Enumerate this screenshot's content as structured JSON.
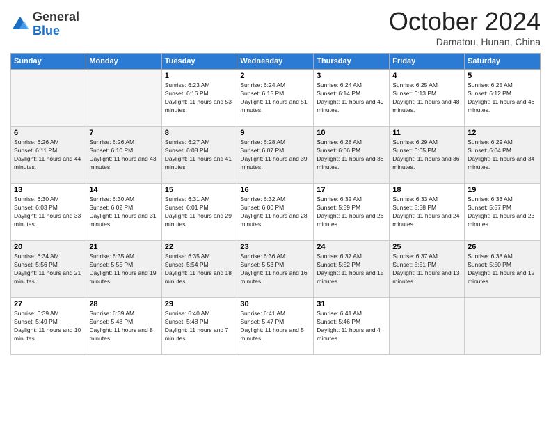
{
  "logo": {
    "general": "General",
    "blue": "Blue"
  },
  "header": {
    "month": "October 2024",
    "location": "Damatou, Hunan, China"
  },
  "weekdays": [
    "Sunday",
    "Monday",
    "Tuesday",
    "Wednesday",
    "Thursday",
    "Friday",
    "Saturday"
  ],
  "weeks": [
    [
      {
        "num": "",
        "empty": true
      },
      {
        "num": "",
        "empty": true
      },
      {
        "num": "1",
        "sunrise": "6:23 AM",
        "sunset": "6:16 PM",
        "daylight": "11 hours and 53 minutes."
      },
      {
        "num": "2",
        "sunrise": "6:24 AM",
        "sunset": "6:15 PM",
        "daylight": "11 hours and 51 minutes."
      },
      {
        "num": "3",
        "sunrise": "6:24 AM",
        "sunset": "6:14 PM",
        "daylight": "11 hours and 49 minutes."
      },
      {
        "num": "4",
        "sunrise": "6:25 AM",
        "sunset": "6:13 PM",
        "daylight": "11 hours and 48 minutes."
      },
      {
        "num": "5",
        "sunrise": "6:25 AM",
        "sunset": "6:12 PM",
        "daylight": "11 hours and 46 minutes."
      }
    ],
    [
      {
        "num": "6",
        "sunrise": "6:26 AM",
        "sunset": "6:11 PM",
        "daylight": "11 hours and 44 minutes."
      },
      {
        "num": "7",
        "sunrise": "6:26 AM",
        "sunset": "6:10 PM",
        "daylight": "11 hours and 43 minutes."
      },
      {
        "num": "8",
        "sunrise": "6:27 AM",
        "sunset": "6:08 PM",
        "daylight": "11 hours and 41 minutes."
      },
      {
        "num": "9",
        "sunrise": "6:28 AM",
        "sunset": "6:07 PM",
        "daylight": "11 hours and 39 minutes."
      },
      {
        "num": "10",
        "sunrise": "6:28 AM",
        "sunset": "6:06 PM",
        "daylight": "11 hours and 38 minutes."
      },
      {
        "num": "11",
        "sunrise": "6:29 AM",
        "sunset": "6:05 PM",
        "daylight": "11 hours and 36 minutes."
      },
      {
        "num": "12",
        "sunrise": "6:29 AM",
        "sunset": "6:04 PM",
        "daylight": "11 hours and 34 minutes."
      }
    ],
    [
      {
        "num": "13",
        "sunrise": "6:30 AM",
        "sunset": "6:03 PM",
        "daylight": "11 hours and 33 minutes."
      },
      {
        "num": "14",
        "sunrise": "6:30 AM",
        "sunset": "6:02 PM",
        "daylight": "11 hours and 31 minutes."
      },
      {
        "num": "15",
        "sunrise": "6:31 AM",
        "sunset": "6:01 PM",
        "daylight": "11 hours and 29 minutes."
      },
      {
        "num": "16",
        "sunrise": "6:32 AM",
        "sunset": "6:00 PM",
        "daylight": "11 hours and 28 minutes."
      },
      {
        "num": "17",
        "sunrise": "6:32 AM",
        "sunset": "5:59 PM",
        "daylight": "11 hours and 26 minutes."
      },
      {
        "num": "18",
        "sunrise": "6:33 AM",
        "sunset": "5:58 PM",
        "daylight": "11 hours and 24 minutes."
      },
      {
        "num": "19",
        "sunrise": "6:33 AM",
        "sunset": "5:57 PM",
        "daylight": "11 hours and 23 minutes."
      }
    ],
    [
      {
        "num": "20",
        "sunrise": "6:34 AM",
        "sunset": "5:56 PM",
        "daylight": "11 hours and 21 minutes."
      },
      {
        "num": "21",
        "sunrise": "6:35 AM",
        "sunset": "5:55 PM",
        "daylight": "11 hours and 19 minutes."
      },
      {
        "num": "22",
        "sunrise": "6:35 AM",
        "sunset": "5:54 PM",
        "daylight": "11 hours and 18 minutes."
      },
      {
        "num": "23",
        "sunrise": "6:36 AM",
        "sunset": "5:53 PM",
        "daylight": "11 hours and 16 minutes."
      },
      {
        "num": "24",
        "sunrise": "6:37 AM",
        "sunset": "5:52 PM",
        "daylight": "11 hours and 15 minutes."
      },
      {
        "num": "25",
        "sunrise": "6:37 AM",
        "sunset": "5:51 PM",
        "daylight": "11 hours and 13 minutes."
      },
      {
        "num": "26",
        "sunrise": "6:38 AM",
        "sunset": "5:50 PM",
        "daylight": "11 hours and 12 minutes."
      }
    ],
    [
      {
        "num": "27",
        "sunrise": "6:39 AM",
        "sunset": "5:49 PM",
        "daylight": "11 hours and 10 minutes."
      },
      {
        "num": "28",
        "sunrise": "6:39 AM",
        "sunset": "5:48 PM",
        "daylight": "11 hours and 8 minutes."
      },
      {
        "num": "29",
        "sunrise": "6:40 AM",
        "sunset": "5:48 PM",
        "daylight": "11 hours and 7 minutes."
      },
      {
        "num": "30",
        "sunrise": "6:41 AM",
        "sunset": "5:47 PM",
        "daylight": "11 hours and 5 minutes."
      },
      {
        "num": "31",
        "sunrise": "6:41 AM",
        "sunset": "5:46 PM",
        "daylight": "11 hours and 4 minutes."
      },
      {
        "num": "",
        "empty": true
      },
      {
        "num": "",
        "empty": true
      }
    ]
  ]
}
